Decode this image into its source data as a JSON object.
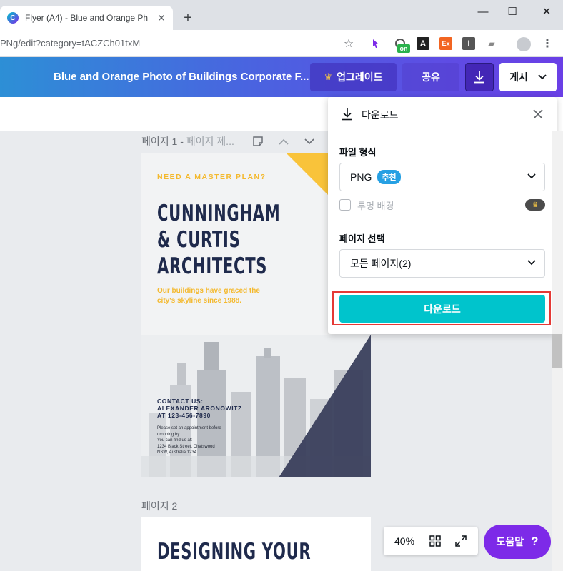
{
  "browser": {
    "tab_title": "Flyer (A4) - Blue and Orange Ph",
    "url": "PNg/edit?category=tACZCh01txM",
    "ext_badge_on": "on"
  },
  "topbar": {
    "doc_title": "Blue and Orange Photo of Buildings Corporate F...",
    "upgrade_label": "업그레이드",
    "share_label": "공유",
    "publish_label": "게시"
  },
  "canvas": {
    "page1_label": "페이지 1 - ",
    "page1_title_placeholder": "페이지 제...",
    "page2_label": "페이지 2"
  },
  "flyer": {
    "tagline": "NEED A MASTER PLAN?",
    "heading_line1": "CUNNINGHAM",
    "heading_line2": "& CURTIS",
    "heading_line3": "ARCHITECTS",
    "sub": "Our buildings have graced the city's skyline since 1988.",
    "contact_line1": "CONTACT US:",
    "contact_line2": "ALEXANDER ARONOWITZ",
    "contact_line3": "AT 123-456-7890",
    "small_line1": "Please set an appointment before",
    "small_line2": "dropping by.",
    "small_line3": "You can find us at:",
    "small_line4": "1234 Black Street, Chatswood",
    "small_line5": "NSW, Australia 1234",
    "page2_heading": "DESIGNING YOUR"
  },
  "download_panel": {
    "title": "다운로드",
    "file_type_label": "파일 형식",
    "file_type_value": "PNG",
    "recommended_badge": "추천",
    "transparent_bg_label": "투명 배경",
    "transparent_bg_checked": false,
    "page_select_label": "페이지 선택",
    "page_select_value": "모든 페이지(2)",
    "download_button": "다운로드"
  },
  "bottom": {
    "zoom": "40%",
    "help_label": "도움말",
    "help_q": "?"
  },
  "colors": {
    "accent_teal": "#00c4cc",
    "purple": "#7d2ae8",
    "highlight_red": "#e53935",
    "flyer_yellow": "#f9c33a",
    "flyer_navy": "#3a3f5c"
  }
}
